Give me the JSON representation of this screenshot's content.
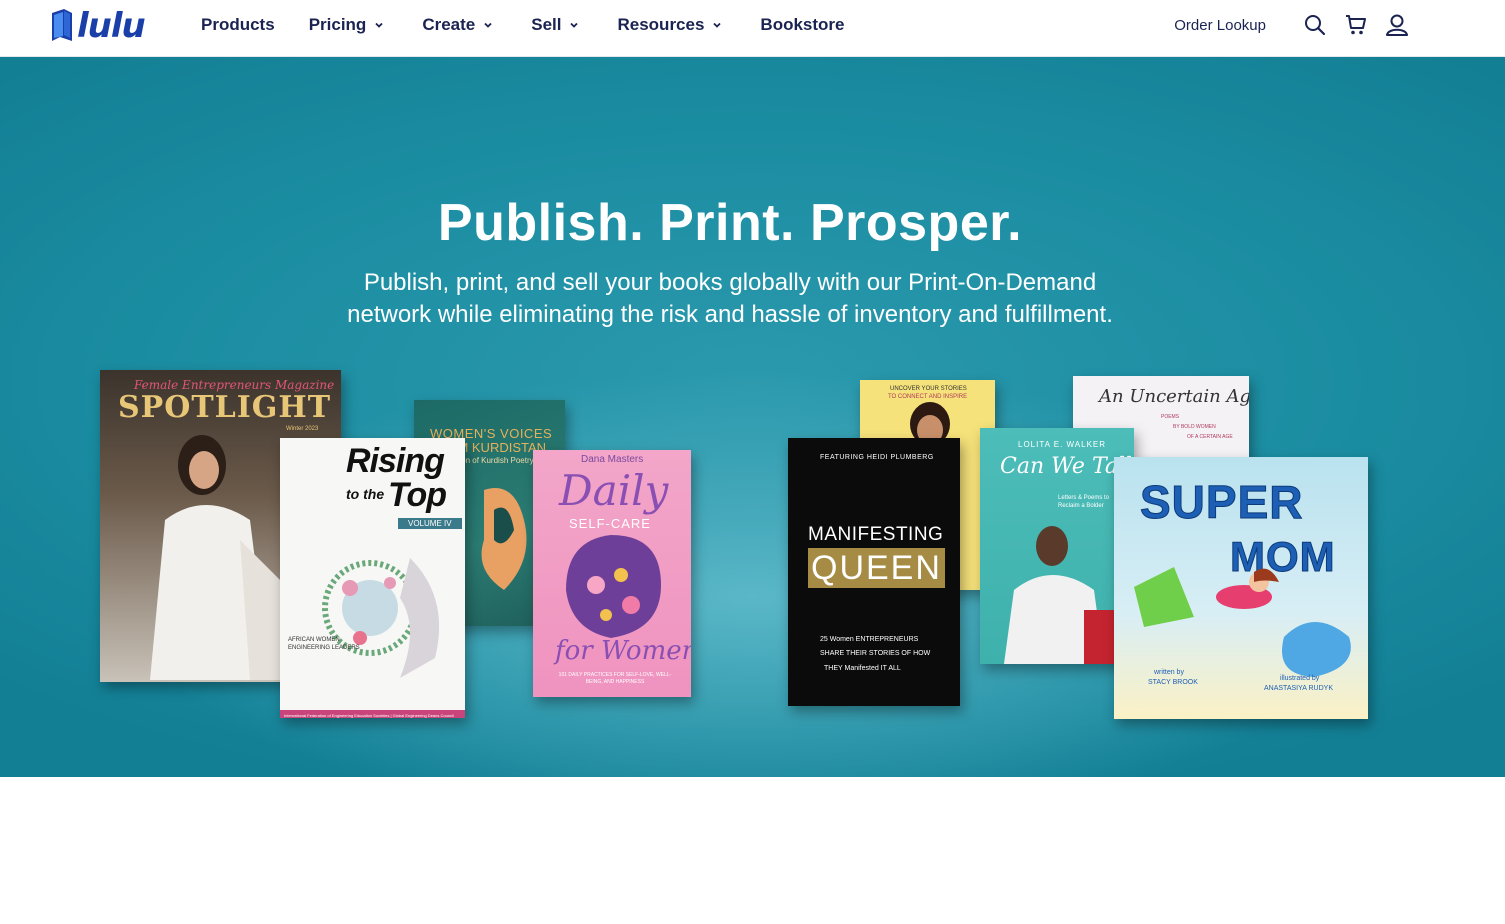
{
  "brand": {
    "name": "lulu",
    "color": "#1a3fa8"
  },
  "nav": {
    "items": [
      {
        "label": "Products",
        "dropdown": false
      },
      {
        "label": "Pricing",
        "dropdown": true
      },
      {
        "label": "Create",
        "dropdown": true
      },
      {
        "label": "Sell",
        "dropdown": true
      },
      {
        "label": "Resources",
        "dropdown": true
      },
      {
        "label": "Bookstore",
        "dropdown": false
      }
    ],
    "order_lookup": "Order Lookup",
    "icons": [
      "search-icon",
      "cart-icon",
      "account-icon"
    ]
  },
  "hero": {
    "title": "Publish. Print. Prosper.",
    "subtitle": "Publish, print, and sell your books globally with our Print-On-Demand network while eliminating the risk and hassle of inventory and fulfillment.",
    "background_color": "#1a8ca1"
  },
  "books": {
    "spotlight": {
      "magazine": "Female Entrepreneurs Magazine",
      "title": "SPOTLIGHT",
      "edition": "Winter 2023"
    },
    "rising": {
      "title_line1": "Rising",
      "title_line2": "to the",
      "title_line3": "Top",
      "volume": "VOLUME IV",
      "subtitle": "AFRICAN WOMEN ENGINEERING LEADERS",
      "footer": "International Federation of Engineering Education Societies | Global Engineering Deans Council"
    },
    "voices": {
      "title_line1": "WOMEN'S VOICES",
      "title_line2": "FROM KURDISTAN",
      "subtitle": "A Selection of Kurdish Poetry"
    },
    "daily": {
      "author": "Dana Masters",
      "title": "Daily",
      "subtitle": "SELF-CARE",
      "for_women": "for Women",
      "tagline": "101 DAILY PRACTICES FOR SELF-LOVE, WELL-BEING, AND HAPPINESS"
    },
    "uncover": {
      "line1": "UNCOVER YOUR STORIES",
      "line2": "TO CONNECT AND INSPIRE"
    },
    "manifesting": {
      "featuring": "FEATURING HEIDI PLUMBERG",
      "title1": "MANIFESTING",
      "title2": "QUEEN",
      "line1": "25 Women ENTREPRENEURS",
      "line2": "SHARE THEIR STORIES OF HOW",
      "line3": "THEY Manifested IT ALL"
    },
    "uncertain": {
      "title": "An Uncertain Age",
      "line1": "POEMS",
      "line2": "BY BOLD WOMEN",
      "line3": "OF A CERTAIN AGE"
    },
    "cantalk": {
      "author": "LOLITA E. WALKER",
      "title": "Can We Talk",
      "subtitle": "Letters & Poems to Reclaim a Bolder"
    },
    "supermom": {
      "title1": "SUPER",
      "title2": "MOM",
      "written": "written by",
      "author": "STACY BROOK",
      "illustrated": "illustrated by",
      "illustrator": "ANASTASIYA RUDYK"
    }
  }
}
